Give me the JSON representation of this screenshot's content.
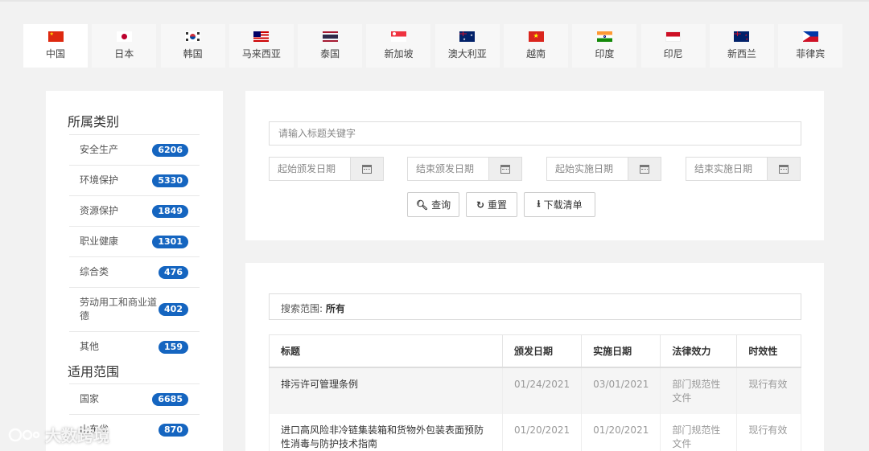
{
  "tabs": [
    {
      "label": "中国",
      "flag": "china-flag-icon",
      "active": true
    },
    {
      "label": "日本",
      "flag": "japan-flag-icon"
    },
    {
      "label": "韩国",
      "flag": "korea-flag-icon"
    },
    {
      "label": "马来西亚",
      "flag": "malaysia-flag-icon"
    },
    {
      "label": "泰国",
      "flag": "thailand-flag-icon"
    },
    {
      "label": "新加坡",
      "flag": "singapore-flag-icon"
    },
    {
      "label": "澳大利亚",
      "flag": "australia-flag-icon"
    },
    {
      "label": "越南",
      "flag": "vietnam-flag-icon"
    },
    {
      "label": "印度",
      "flag": "india-flag-icon"
    },
    {
      "label": "印尼",
      "flag": "indonesia-flag-icon"
    },
    {
      "label": "新西兰",
      "flag": "new-zealand-flag-icon"
    },
    {
      "label": "菲律宾",
      "flag": "philippines-flag-icon"
    }
  ],
  "sidebar": {
    "category_title": "所属类别",
    "categories": [
      {
        "label": "安全生产",
        "count": "6206"
      },
      {
        "label": "环境保护",
        "count": "5330"
      },
      {
        "label": "资源保护",
        "count": "1849"
      },
      {
        "label": "职业健康",
        "count": "1301"
      },
      {
        "label": "综合类",
        "count": "476"
      },
      {
        "label": "劳动用工和商业道德",
        "count": "402"
      },
      {
        "label": "其他",
        "count": "159"
      }
    ],
    "scope_title": "适用范围",
    "scopes": [
      {
        "label": "国家",
        "count": "6685"
      },
      {
        "label": "山东省",
        "count": "870"
      }
    ]
  },
  "search": {
    "keyword_placeholder": "请输入标题关键字",
    "issue_start_placeholder": "起始颁发日期",
    "issue_end_placeholder": "结束颁发日期",
    "effective_start_placeholder": "起始实施日期",
    "effective_end_placeholder": "结束实施日期",
    "query_label": "查询",
    "reset_label": "重置",
    "download_label": "下载清单"
  },
  "results": {
    "scope_prefix": "搜索范围: ",
    "scope_value": "所有",
    "headers": {
      "title": "标题",
      "issue_date": "颁发日期",
      "effective_date": "实施日期",
      "legal_effect": "法律效力",
      "validity": "时效性"
    },
    "rows": [
      {
        "title": "排污许可管理条例",
        "issue_date": "01/24/2021",
        "effective_date": "03/01/2021",
        "legal_effect": "部门规范性文件",
        "validity": "现行有效"
      },
      {
        "title": "进口高风险非冷链集装箱和货物外包装表面预防性消毒与防护技术指南",
        "issue_date": "01/20/2021",
        "effective_date": "01/20/2021",
        "legal_effect": "部门规范性文件",
        "validity": "现行有效"
      }
    ]
  },
  "watermark": {
    "text": "大数跨境"
  },
  "colors": {
    "badge": "#1565c0",
    "background": "#f2f2f2",
    "panel": "#ffffff"
  }
}
